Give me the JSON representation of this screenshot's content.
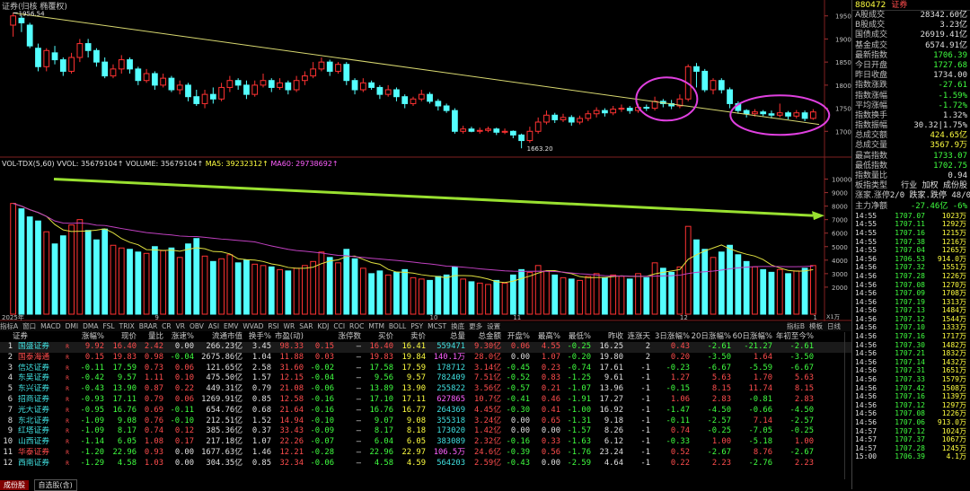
{
  "chart_title": "证券(归核 椭覆权)",
  "price_axis": [
    "1950",
    "1900",
    "1850",
    "1800",
    "1750",
    "1700"
  ],
  "price_high_label": "1956.54",
  "price_low_label": "1663.20",
  "vol_header": {
    "name": "VOL-TDX(5,60)",
    "vvol": "VVOL: 35679104↑",
    "volume": "VOLUME: 35679104↑",
    "ma5": "MA5: 39232312↑",
    "ma60": "MA60: 29738692↑"
  },
  "vol_axis": [
    "10000",
    "9000",
    "8000",
    "7000",
    "6000",
    "5000",
    "4000",
    "3000",
    "2000"
  ],
  "vol_unit": "X1万",
  "date_labels": [
    "2025年",
    "9",
    "10",
    "11",
    "12",
    "1"
  ],
  "chart_data": {
    "type": "candlestick",
    "title": "证券(归核 椭覆权)",
    "ylim": [
      1650,
      1965
    ],
    "vol_ylim": [
      0,
      10500
    ],
    "candles": [
      [
        1930,
        1950,
        1956.54,
        1905,
        8200
      ],
      [
        1945,
        1935,
        1950,
        1915,
        7800
      ],
      [
        1930,
        1885,
        1935,
        1880,
        7200
      ],
      [
        1880,
        1840,
        1890,
        1830,
        6900
      ],
      [
        1840,
        1875,
        1880,
        1830,
        6100
      ],
      [
        1870,
        1855,
        1885,
        1845,
        5200
      ],
      [
        1855,
        1830,
        1860,
        1820,
        5800
      ],
      [
        1830,
        1860,
        1870,
        1825,
        6600
      ],
      [
        1860,
        1890,
        1900,
        1850,
        7000
      ],
      [
        1890,
        1875,
        1900,
        1860,
        6200
      ],
      [
        1875,
        1850,
        1880,
        1840,
        5500
      ],
      [
        1850,
        1820,
        1860,
        1815,
        6300
      ],
      [
        1820,
        1835,
        1845,
        1815,
        5100
      ],
      [
        1835,
        1855,
        1865,
        1825,
        4900
      ],
      [
        1855,
        1835,
        1860,
        1825,
        4800
      ],
      [
        1835,
        1810,
        1840,
        1800,
        4600
      ],
      [
        1810,
        1825,
        1835,
        1805,
        4500
      ],
      [
        1825,
        1800,
        1830,
        1790,
        5000
      ],
      [
        1800,
        1815,
        1825,
        1795,
        4700
      ],
      [
        1815,
        1790,
        1820,
        1785,
        4900
      ],
      [
        1790,
        1800,
        1810,
        1780,
        4200
      ],
      [
        1800,
        1775,
        1805,
        1765,
        5200
      ],
      [
        1775,
        1760,
        1790,
        1755,
        5600
      ],
      [
        1760,
        1780,
        1790,
        1750,
        4300
      ],
      [
        1780,
        1770,
        1795,
        1760,
        3900
      ],
      [
        1770,
        1795,
        1805,
        1765,
        4100
      ],
      [
        1795,
        1810,
        1820,
        1785,
        4400
      ],
      [
        1810,
        1800,
        1815,
        1790,
        3800
      ],
      [
        1800,
        1780,
        1810,
        1770,
        4000
      ],
      [
        1780,
        1800,
        1810,
        1775,
        3700
      ],
      [
        1800,
        1810,
        1825,
        1795,
        3600
      ],
      [
        1810,
        1795,
        1815,
        1785,
        3500
      ],
      [
        1795,
        1805,
        1815,
        1790,
        3300
      ],
      [
        1805,
        1790,
        1810,
        1780,
        3200
      ],
      [
        1790,
        1810,
        1820,
        1785,
        3400
      ],
      [
        1810,
        1820,
        1830,
        1800,
        3600
      ],
      [
        1820,
        1835,
        1850,
        1815,
        3900
      ],
      [
        1835,
        1850,
        1860,
        1830,
        4600
      ],
      [
        1850,
        1830,
        1855,
        1820,
        4200
      ],
      [
        1830,
        1845,
        1850,
        1825,
        3800
      ],
      [
        1845,
        1810,
        1850,
        1800,
        4800
      ],
      [
        1810,
        1790,
        1815,
        1780,
        4100
      ],
      [
        1790,
        1805,
        1815,
        1785,
        3400
      ],
      [
        1805,
        1795,
        1810,
        1790,
        3000
      ],
      [
        1795,
        1780,
        1800,
        1770,
        3200
      ],
      [
        1780,
        1790,
        1800,
        1775,
        2900
      ],
      [
        1790,
        1775,
        1795,
        1765,
        3100
      ],
      [
        1775,
        1760,
        1780,
        1750,
        3300
      ],
      [
        1760,
        1770,
        1775,
        1755,
        2700
      ],
      [
        1770,
        1780,
        1790,
        1765,
        2600
      ],
      [
        1780,
        1765,
        1785,
        1760,
        2500
      ],
      [
        1765,
        1755,
        1770,
        1745,
        2800
      ],
      [
        1755,
        1745,
        1760,
        1740,
        2900
      ],
      [
        1745,
        1700,
        1750,
        1695,
        3500
      ],
      [
        1700,
        1705,
        1712,
        1695,
        2600
      ],
      [
        1705,
        1700,
        1710,
        1698,
        2400
      ],
      [
        1700,
        1702,
        1708,
        1695,
        2300
      ],
      [
        1702,
        1705,
        1710,
        1698,
        2200
      ],
      [
        1705,
        1698,
        1708,
        1692,
        2500
      ],
      [
        1698,
        1700,
        1706,
        1694,
        2300
      ],
      [
        1700,
        1692,
        1702,
        1685,
        2900
      ],
      [
        1692,
        1680,
        1695,
        1663.2,
        3300
      ],
      [
        1680,
        1700,
        1710,
        1675,
        3100
      ],
      [
        1700,
        1720,
        1730,
        1695,
        3600
      ],
      [
        1720,
        1735,
        1745,
        1715,
        3200
      ],
      [
        1735,
        1725,
        1740,
        1718,
        2900
      ],
      [
        1725,
        1730,
        1738,
        1720,
        2700
      ],
      [
        1730,
        1720,
        1735,
        1712,
        2600
      ],
      [
        1720,
        1728,
        1734,
        1715,
        2500
      ],
      [
        1728,
        1738,
        1745,
        1722,
        2800
      ],
      [
        1738,
        1745,
        1752,
        1730,
        3000
      ],
      [
        1745,
        1740,
        1750,
        1732,
        2700
      ],
      [
        1740,
        1748,
        1755,
        1735,
        2900
      ],
      [
        1748,
        1750,
        1758,
        1742,
        2800
      ],
      [
        1750,
        1745,
        1755,
        1738,
        2600
      ],
      [
        1745,
        1752,
        1760,
        1740,
        3000
      ],
      [
        1752,
        1750,
        1758,
        1744,
        2700
      ],
      [
        1750,
        1765,
        1775,
        1745,
        3800
      ],
      [
        1765,
        1760,
        1770,
        1752,
        3400
      ],
      [
        1760,
        1755,
        1768,
        1748,
        3100
      ],
      [
        1755,
        1770,
        1780,
        1750,
        3500
      ],
      [
        1770,
        1840,
        1845,
        1765,
        6500
      ],
      [
        1840,
        1830,
        1848,
        1795,
        5500
      ],
      [
        1830,
        1790,
        1835,
        1785,
        4800
      ],
      [
        1790,
        1810,
        1815,
        1780,
        4200
      ],
      [
        1810,
        1790,
        1815,
        1782,
        4600
      ],
      [
        1790,
        1760,
        1795,
        1750,
        5100
      ],
      [
        1760,
        1745,
        1765,
        1738,
        4400
      ],
      [
        1745,
        1738,
        1748,
        1730,
        3900
      ],
      [
        1738,
        1742,
        1748,
        1732,
        3500
      ],
      [
        1742,
        1738,
        1746,
        1733,
        3300
      ],
      [
        1738,
        1735,
        1745,
        1728,
        3100
      ],
      [
        1735,
        1740,
        1760,
        1730,
        3300
      ],
      [
        1740,
        1733,
        1744,
        1726,
        3000
      ],
      [
        1733,
        1740,
        1746,
        1728,
        3200
      ],
      [
        1740,
        1728,
        1745,
        1722,
        3400
      ],
      [
        1728,
        1742,
        1748,
        1725,
        3600
      ]
    ],
    "ma5_close": [],
    "trendline": {
      "from_price": 1956.54,
      "to_price": 1715
    }
  },
  "right_panel": {
    "code": "880472",
    "name": "证券",
    "rows": [
      {
        "k": "A股成交",
        "v": "28342.60亿",
        "c": "white"
      },
      {
        "k": "B股成交",
        "v": "3.23亿",
        "c": "white"
      },
      {
        "k": "国债成交",
        "v": "26919.41亿",
        "c": "white"
      },
      {
        "k": "基金成交",
        "v": "6574.91亿",
        "c": "white"
      },
      {
        "k": "最新指数",
        "v": "1706.39",
        "c": "green"
      },
      {
        "k": "今日开盘",
        "v": "1727.68",
        "c": "green"
      },
      {
        "k": "昨日收盘",
        "v": "1734.00",
        "c": "white"
      },
      {
        "k": "指数涨跌",
        "v": "-27.61",
        "c": "green"
      },
      {
        "k": "指数涨幅",
        "v": "-1.59%",
        "c": "green"
      },
      {
        "k": "平均涨幅",
        "v": "-1.72%",
        "c": "green"
      },
      {
        "k": "指数换手",
        "v": "1.32%",
        "c": "white"
      },
      {
        "k": "指数振幅",
        "v": "30.32|1.75%",
        "c": "white"
      },
      {
        "k": "总成交额",
        "v": "424.65亿",
        "c": "yellow"
      },
      {
        "k": "总成交量",
        "v": "3567.9万",
        "c": "yellow"
      },
      {
        "k": "最高指数",
        "v": "1733.07",
        "c": "green"
      },
      {
        "k": "最低指数",
        "v": "1702.75",
        "c": "green"
      },
      {
        "k": "指数量比",
        "v": "0.94",
        "c": "white"
      },
      {
        "k": "板指类型",
        "v": "行业 加权 成份股",
        "c": "white"
      },
      {
        "k": "涨家.涨停",
        "v": "2/0 跌家.跌停 48/0",
        "c": "white"
      },
      {
        "k": "主力净额",
        "v": "-27.46亿 -6%",
        "c": "green"
      }
    ],
    "ticks": [
      [
        "14:55",
        "1707.07",
        "1023万"
      ],
      [
        "14:55",
        "1707.11",
        "1292万"
      ],
      [
        "14:55",
        "1707.16",
        "1215万"
      ],
      [
        "14:55",
        "1707.38",
        "1216万"
      ],
      [
        "14:55",
        "1707.04",
        "1265万"
      ],
      [
        "14:56",
        "1706.53",
        "914.0万"
      ],
      [
        "14:56",
        "1707.32",
        "1551万"
      ],
      [
        "14:56",
        "1707.28",
        "1226万"
      ],
      [
        "14:56",
        "1707.08",
        "1270万"
      ],
      [
        "14:56",
        "1707.09",
        "1708万"
      ],
      [
        "14:56",
        "1707.19",
        "1313万"
      ],
      [
        "14:56",
        "1707.13",
        "1484万"
      ],
      [
        "14:56",
        "1707.12",
        "1544万"
      ],
      [
        "14:56",
        "1707.10",
        "1333万"
      ],
      [
        "14:56",
        "1707.16",
        "1717万"
      ],
      [
        "14:56",
        "1707.30",
        "1482万"
      ],
      [
        "14:56",
        "1707.21",
        "1832万"
      ],
      [
        "14:56",
        "1707.14",
        "1432万"
      ],
      [
        "14:56",
        "1707.31",
        "1651万"
      ],
      [
        "14:56",
        "1707.33",
        "1579万"
      ],
      [
        "14:56",
        "1707.42",
        "1508万"
      ],
      [
        "14:56",
        "1707.16",
        "1139万"
      ],
      [
        "14:56",
        "1707.12",
        "1297万"
      ],
      [
        "14:56",
        "1707.08",
        "1226万"
      ],
      [
        "14:56",
        "1707.06",
        "913.0万"
      ],
      [
        "14:57",
        "1707.12",
        "1024万"
      ],
      [
        "14:57",
        "1707.37",
        "1067万"
      ],
      [
        "14:57",
        "1707.28",
        "1245万"
      ],
      [
        "15:00",
        "1706.39",
        "4.1万"
      ]
    ]
  },
  "toolbar": [
    "指标A",
    "窗口",
    "MACD",
    "DMI",
    "DMA",
    "FSL",
    "TRIX",
    "BRAR",
    "CR",
    "VR",
    "OBV",
    "ASI",
    "EMV",
    "WVAD",
    "RSI",
    "WR",
    "SAR",
    "KDJ",
    "CCI",
    "ROC",
    "MTM",
    "BOLL",
    "PSY",
    "MCST",
    "换底",
    "更多",
    "设置"
  ],
  "toolbar_right": [
    "指标B",
    "模板",
    "日线"
  ],
  "table": {
    "headers": [
      "",
      "证券",
      "",
      "涨幅%",
      "现价",
      "量比",
      "涨速%",
      "流通市值",
      "换手%",
      "市盈(动)",
      "涨停数",
      "买价",
      "卖价",
      "总量",
      "总金额",
      "开盘%",
      "最高%",
      "最低%",
      "昨收",
      "连涨天",
      "3日涨幅%",
      "20日涨幅%",
      "60日涨幅%",
      "年初至今%"
    ],
    "rows": [
      [
        "1",
        "国盛证券",
        "R",
        "9.92",
        "16.40",
        "2.42",
        "0.00",
        "266.23亿",
        "3.45",
        "98.33",
        "0.15",
        "—",
        "16.40",
        "16.41",
        "559471",
        "9.30亿",
        "0.06",
        "4.55",
        "-0.25",
        "16.25",
        "2",
        "0.43",
        "-2.61",
        "-21.27",
        "-2.61"
      ],
      [
        "2",
        "国泰海通",
        "R",
        "0.15",
        "19.83",
        "0.98",
        "-0.04",
        "2675.86亿",
        "1.04",
        "11.88",
        "0.03",
        "—",
        "19.83",
        "19.84",
        "140.1万",
        "28.0亿",
        "0.00",
        "1.07",
        "-0.20",
        "19.80",
        "2",
        "0.20",
        "-3.50",
        "1.64",
        "-3.50"
      ],
      [
        "3",
        "信达证券",
        "R",
        "-0.11",
        "17.59",
        "0.73",
        "0.06",
        "121.65亿",
        "2.58",
        "31.60",
        "-0.02",
        "—",
        "17.58",
        "17.59",
        "178712",
        "3.14亿",
        "-0.45",
        "0.23",
        "-0.74",
        "17.61",
        "-1",
        "-0.23",
        "-6.67",
        "-5.59",
        "-6.67"
      ],
      [
        "4",
        "东吴证券",
        "R",
        "-0.42",
        "9.57",
        "1.11",
        "0.10",
        "475.50亿",
        "1.57",
        "12.15",
        "-0.04",
        "—",
        "9.56",
        "9.57",
        "782409",
        "7.51亿",
        "-0.52",
        "0.83",
        "-1.25",
        "9.61",
        "-1",
        "1.27",
        "5.63",
        "1.70",
        "5.63"
      ],
      [
        "5",
        "东兴证券",
        "R",
        "-0.43",
        "13.90",
        "0.87",
        "0.22",
        "449.31亿",
        "0.79",
        "21.08",
        "-0.06",
        "—",
        "13.89",
        "13.90",
        "255822",
        "3.56亿",
        "-0.57",
        "0.21",
        "-1.07",
        "13.96",
        "-1",
        "-0.15",
        "8.15",
        "11.74",
        "8.15"
      ],
      [
        "6",
        "招商证券",
        "R",
        "-0.93",
        "17.11",
        "0.79",
        "0.06",
        "1269.91亿",
        "0.85",
        "12.58",
        "-0.16",
        "—",
        "17.10",
        "17.11",
        "627865",
        "10.7亿",
        "-0.41",
        "0.46",
        "-1.91",
        "17.27",
        "-1",
        "1.06",
        "2.83",
        "-0.81",
        "2.83"
      ],
      [
        "7",
        "光大证券",
        "R",
        "-0.95",
        "16.76",
        "0.69",
        "-0.11",
        "654.76亿",
        "0.68",
        "21.64",
        "-0.16",
        "—",
        "16.76",
        "16.77",
        "264369",
        "4.45亿",
        "-0.30",
        "0.41",
        "-1.00",
        "16.92",
        "-1",
        "-1.47",
        "-4.50",
        "-0.66",
        "-4.50"
      ],
      [
        "8",
        "东北证券",
        "R",
        "-1.09",
        "9.08",
        "0.76",
        "-0.10",
        "212.51亿",
        "1.52",
        "14.94",
        "-0.10",
        "—",
        "9.07",
        "9.08",
        "355318",
        "3.24亿",
        "0.00",
        "0.65",
        "-1.31",
        "9.18",
        "-1",
        "-0.11",
        "-2.57",
        "7.14",
        "-2.57"
      ],
      [
        "9",
        "红塔证券",
        "R",
        "-1.09",
        "8.17",
        "0.74",
        "0.12",
        "385.36亿",
        "0.37",
        "33.43",
        "-0.09",
        "—",
        "8.17",
        "8.18",
        "173020",
        "1.42亿",
        "0.00",
        "0.00",
        "-1.57",
        "8.26",
        "-1",
        "0.74",
        "-0.25",
        "-7.05",
        "-0.25"
      ],
      [
        "10",
        "山西证券",
        "R",
        "-1.14",
        "6.05",
        "1.08",
        "0.17",
        "217.18亿",
        "1.07",
        "22.26",
        "-0.07",
        "—",
        "6.04",
        "6.05",
        "383089",
        "2.32亿",
        "-0.16",
        "0.33",
        "-1.63",
        "6.12",
        "-1",
        "-0.33",
        "1.00",
        "-5.18",
        "1.00"
      ],
      [
        "11",
        "华泰证券",
        "R",
        "-1.20",
        "22.96",
        "0.93",
        "0.00",
        "1677.63亿",
        "1.46",
        "12.21",
        "-0.28",
        "—",
        "22.96",
        "22.97",
        "106.5万",
        "24.6亿",
        "-0.39",
        "0.56",
        "-1.76",
        "23.24",
        "-1",
        "0.52",
        "-2.67",
        "8.76",
        "-2.67"
      ],
      [
        "12",
        "西南证券",
        "R",
        "-1.29",
        "4.58",
        "1.03",
        "0.00",
        "304.35亿",
        "0.85",
        "32.34",
        "-0.06",
        "—",
        "4.58",
        "4.59",
        "564203",
        "2.59亿",
        "-0.43",
        "0.00",
        "-2.59",
        "4.64",
        "-1",
        "0.22",
        "2.23",
        "-2.76",
        "2.23"
      ]
    ]
  },
  "bottom_tabs": [
    "成份股",
    "自选股(含)"
  ]
}
